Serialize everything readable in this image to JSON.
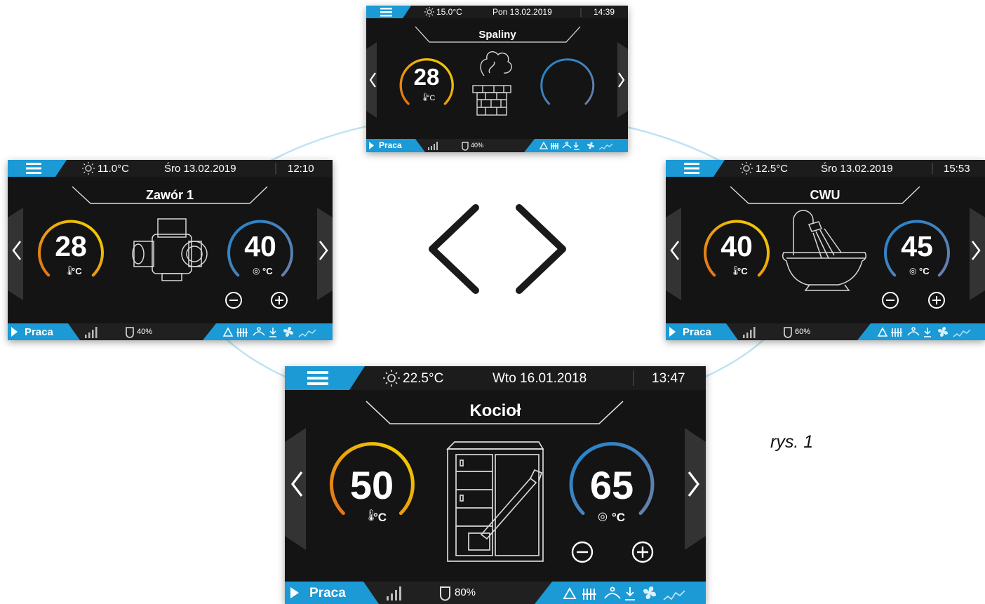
{
  "caption": "rys. 1",
  "screens": [
    {
      "id": "spaliny",
      "header": {
        "weather": "15.0°C",
        "date": "Pon 13.02.2019",
        "time": "14:39"
      },
      "title": "Spaliny",
      "left_gauge": {
        "value": "28",
        "unit": "°C",
        "icon": "thermometer-icon"
      },
      "right_gauge": {
        "value": "",
        "unit": ""
      },
      "footer": {
        "status": "Praca",
        "level": "40%"
      }
    },
    {
      "id": "zawor",
      "header": {
        "weather": "11.0°C",
        "date": "Śro 13.02.2019",
        "time": "12:10"
      },
      "title": "Zawór 1",
      "left_gauge": {
        "value": "28",
        "unit": "°C",
        "icon": "thermometer-icon"
      },
      "right_gauge": {
        "value": "40",
        "unit": "°C",
        "icon": "setpoint-icon"
      },
      "footer": {
        "status": "Praca",
        "level": "40%"
      }
    },
    {
      "id": "cwu",
      "header": {
        "weather": "12.5°C",
        "date": "Śro 13.02.2019",
        "time": "15:53"
      },
      "title": "CWU",
      "left_gauge": {
        "value": "40",
        "unit": "°C",
        "icon": "thermometer-icon"
      },
      "right_gauge": {
        "value": "45",
        "unit": "°C",
        "icon": "setpoint-icon"
      },
      "footer": {
        "status": "Praca",
        "level": "60%"
      }
    },
    {
      "id": "kociol",
      "header": {
        "weather": "22.5°C",
        "date": "Wto 16.01.2018",
        "time": "13:47"
      },
      "title": "Kocioł",
      "left_gauge": {
        "value": "50",
        "unit": "°C",
        "icon": "thermometer-icon"
      },
      "right_gauge": {
        "value": "65",
        "unit": "°C",
        "icon": "setpoint-icon"
      },
      "footer": {
        "status": "Praca",
        "level": "80%"
      }
    }
  ],
  "colors": {
    "screen_bg": "#141414",
    "header_blue": "#1b9ad6",
    "gauge_hot_start": "#e2701a",
    "gauge_hot_end": "#f4d500",
    "gauge_cold_start": "#1f86d0",
    "gauge_cold_end": "#6b7fa8",
    "connector": "#bfe3f3"
  },
  "footer_icons": [
    "warning-icon",
    "radiator-icon",
    "hand-wash-icon",
    "dhw-icon",
    "fan-icon",
    "feeder-icon"
  ]
}
